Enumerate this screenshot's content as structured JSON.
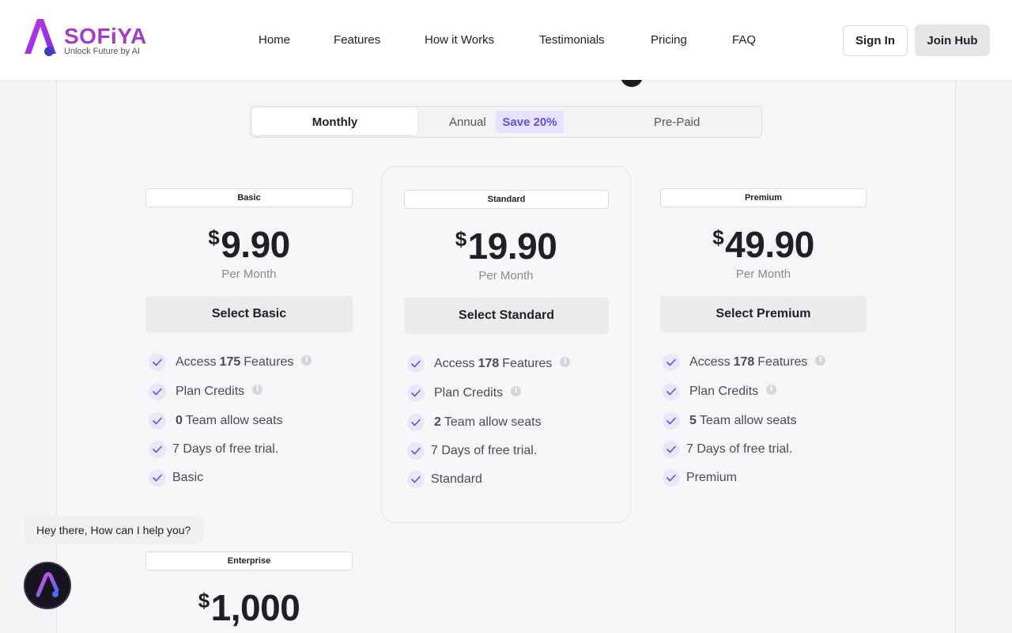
{
  "brand": {
    "name": "SOFiYA",
    "tagline": "Unlock Future by AI"
  },
  "nav": [
    {
      "label": "Home"
    },
    {
      "label": "Features"
    },
    {
      "label": "How it Works"
    },
    {
      "label": "Testimonials"
    },
    {
      "label": "Pricing"
    },
    {
      "label": "FAQ"
    }
  ],
  "auth": {
    "sign_in": "Sign In",
    "join": "Join Hub"
  },
  "billing": {
    "monthly": "Monthly",
    "annual": "Annual",
    "save_badge": "Save 20%",
    "prepaid": "Pre-Paid",
    "selected": "Monthly"
  },
  "plans": [
    {
      "tag": "Basic",
      "currency": "$",
      "price": "9.90",
      "period": "Per Month",
      "button": "Select Basic",
      "features": {
        "access_prefix": "Access",
        "access_count": "175",
        "access_suffix": "Features",
        "credits": "Plan Credits",
        "seats_count": "0",
        "seats_label": "Team allow seats",
        "trial": "7 Days of free trial.",
        "tier": "Basic"
      }
    },
    {
      "tag": "Standard",
      "currency": "$",
      "price": "19.90",
      "period": "Per Month",
      "button": "Select Standard",
      "features": {
        "access_prefix": "Access",
        "access_count": "178",
        "access_suffix": "Features",
        "credits": "Plan Credits",
        "seats_count": "2",
        "seats_label": "Team allow seats",
        "trial": "7 Days of free trial.",
        "tier": "Standard"
      }
    },
    {
      "tag": "Premium",
      "currency": "$",
      "price": "49.90",
      "period": "Per Month",
      "button": "Select Premium",
      "features": {
        "access_prefix": "Access",
        "access_count": "178",
        "access_suffix": "Features",
        "credits": "Plan Credits",
        "seats_count": "5",
        "seats_label": "Team allow seats",
        "trial": "7 Days of free trial.",
        "tier": "Premium"
      }
    },
    {
      "tag": "Enterprise",
      "currency": "$",
      "price": "1,000"
    }
  ],
  "chat": {
    "greeting": "Hey there, How can I help you?"
  },
  "colors": {
    "brand": "#a23cc9",
    "accent": "#6b4cd6",
    "check_bg": "#e9e6f8",
    "check_stroke": "#6b4cd6"
  },
  "icons": {
    "check": "check-icon",
    "info": "info-icon",
    "logo": "logo-mark-icon",
    "chat": "chat-avatar-icon"
  }
}
